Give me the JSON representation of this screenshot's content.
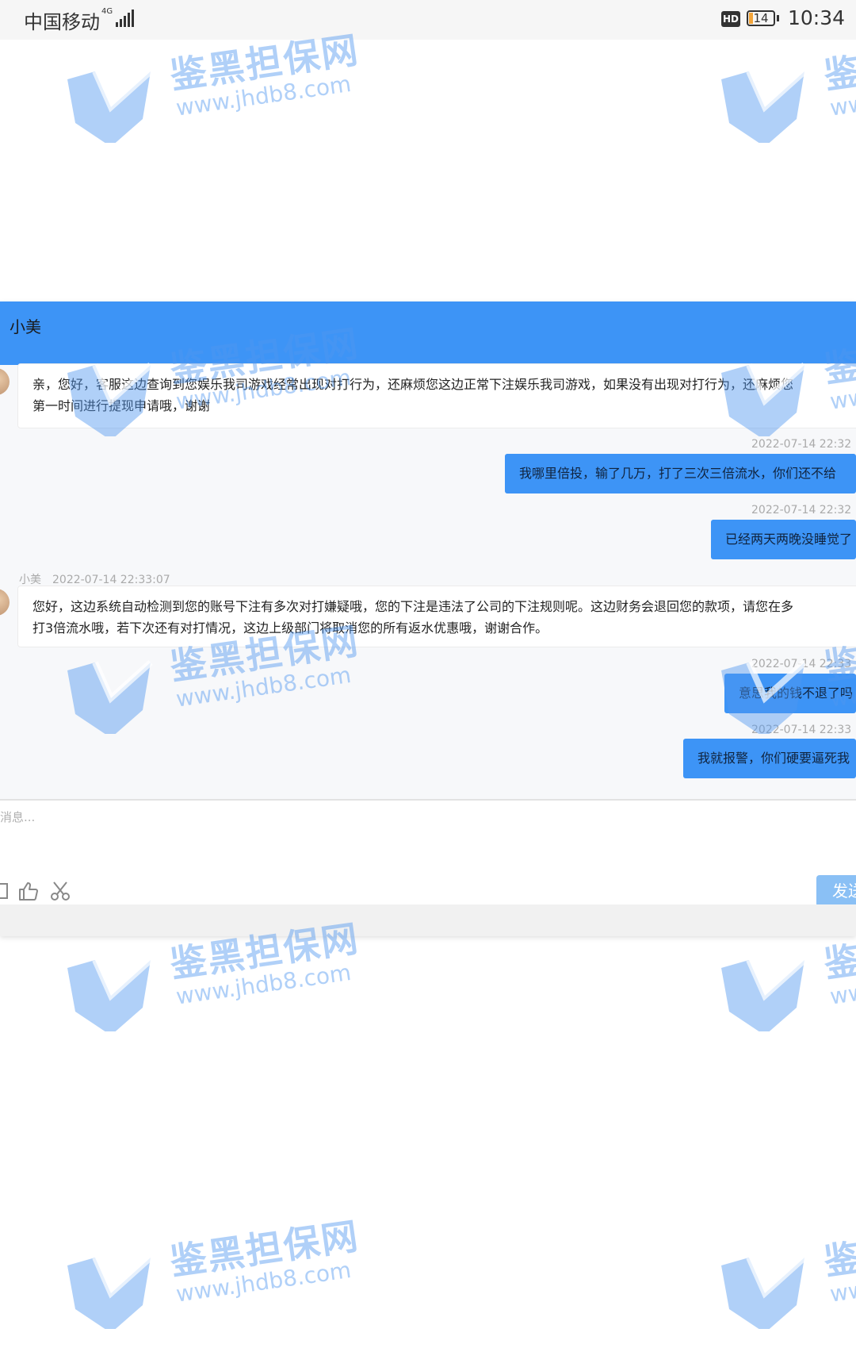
{
  "status_bar": {
    "carrier": "中国移动",
    "network": "4G",
    "hd": "HD",
    "battery": "14",
    "time": "10:34"
  },
  "chat": {
    "title": "小美",
    "messages": [
      {
        "direction": "in",
        "lines": [
          "亲，您好，客服这边查询到您娱乐我司游戏经常出现对打行为，还麻烦您这边正常下注娱乐我司游戏，如果没有出现对打行为，还麻烦您",
          "第一时间进行提现申请哦，谢谢"
        ]
      },
      {
        "direction": "out",
        "timestamp": "2022-07-14 22:32",
        "text": "我哪里倍投，输了几万，打了三次三倍流水，你们还不给"
      },
      {
        "direction": "out",
        "timestamp": "2022-07-14 22:32",
        "text": "已经两天两晚没睡觉了"
      },
      {
        "direction": "in",
        "sender": "小美",
        "timestamp": "2022-07-14 22:33:07",
        "lines": [
          "您好，这边系统自动检测到您的账号下注有多次对打嫌疑哦，您的下注是违法了公司的下注规则呢。这边财务会退回您的款项，请您在多",
          "打3倍流水哦，若下次还有对打情况，这边上级部门将取消您的所有返水优惠哦，谢谢合作。"
        ]
      },
      {
        "direction": "out",
        "timestamp": "2022-07-14 22:33",
        "text": "意思我的钱不退了吗"
      },
      {
        "direction": "out",
        "timestamp": "2022-07-14 22:33",
        "text": "我就报警，你们硬要逼死我"
      }
    ],
    "input_placeholder": "消息...",
    "send_label": "发送"
  },
  "watermark": {
    "cn": "鉴黑担保网",
    "url": "www.jhdb8.com"
  },
  "colors": {
    "header_blue": "#3d94f6",
    "bubble_out": "#3d94f6",
    "send_button": "#8ac0f5",
    "watermark": "#5096f0"
  }
}
